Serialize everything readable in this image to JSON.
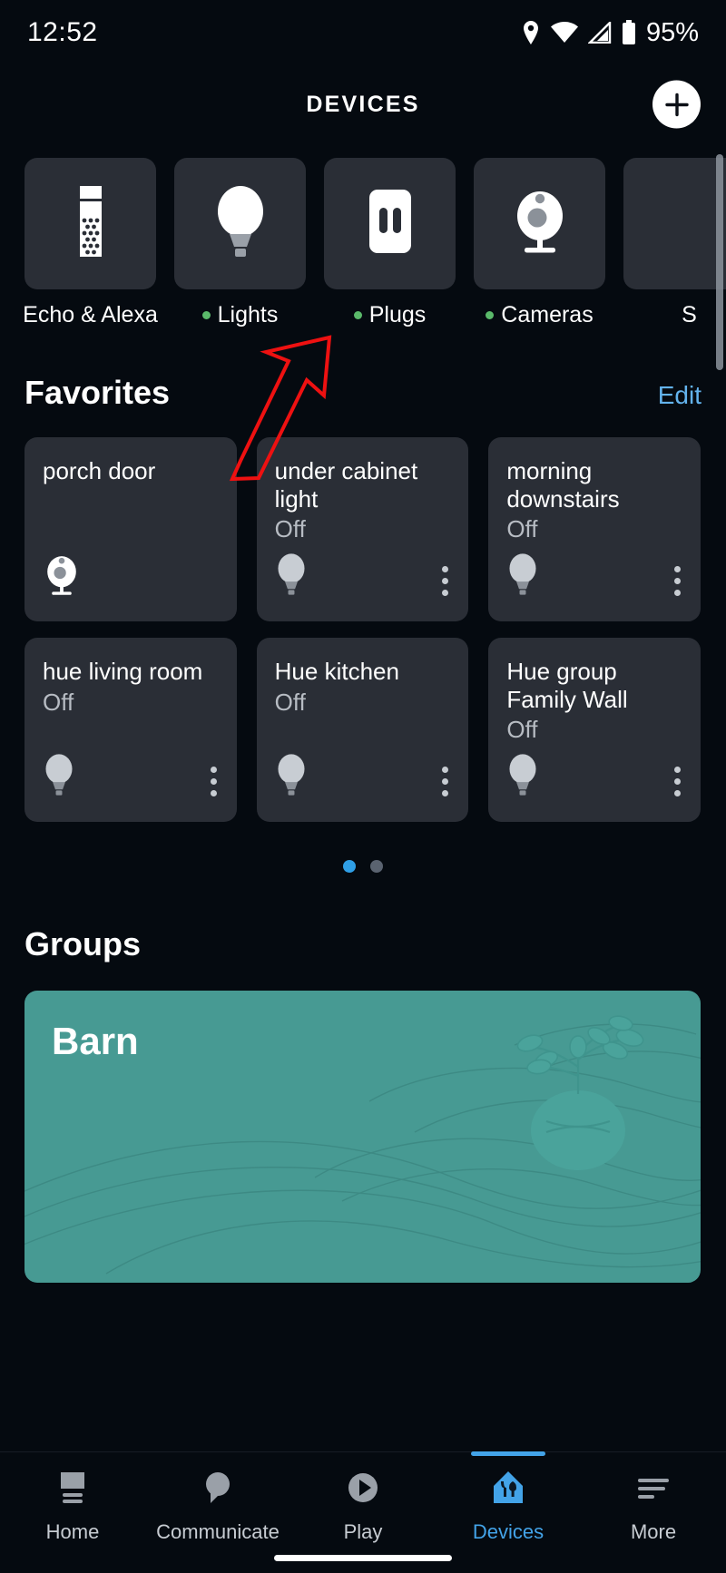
{
  "statusbar": {
    "time": "12:52",
    "battery_percent": "95%",
    "icons": [
      "location-pin-icon",
      "wifi-icon",
      "cellular-signal-icon",
      "battery-icon"
    ]
  },
  "header": {
    "title": "DEVICES",
    "add_label": "+"
  },
  "categories": [
    {
      "label": "Echo & Alexa",
      "icon": "echo-speaker-icon",
      "has_status_dot": false
    },
    {
      "label": "Lights",
      "icon": "light-bulb-icon",
      "has_status_dot": true
    },
    {
      "label": "Plugs",
      "icon": "wall-outlet-icon",
      "has_status_dot": true
    },
    {
      "label": "Cameras",
      "icon": "camera-icon",
      "has_status_dot": true
    },
    {
      "label": "S",
      "icon": "partial-tile-icon",
      "has_status_dot": false
    }
  ],
  "favorites": {
    "title": "Favorites",
    "edit_label": "Edit",
    "cards": [
      {
        "name": "porch door",
        "status": "",
        "icon": "camera-icon",
        "has_menu": false
      },
      {
        "name": "under cabinet light",
        "status": "Off",
        "icon": "light-bulb-icon",
        "has_menu": true
      },
      {
        "name": "morning downstairs",
        "status": "Off",
        "icon": "light-bulb-icon",
        "has_menu": true
      },
      {
        "name": "hue living room",
        "status": "Off",
        "icon": "light-bulb-icon",
        "has_menu": true
      },
      {
        "name": "Hue kitchen",
        "status": "Off",
        "icon": "light-bulb-icon",
        "has_menu": true
      },
      {
        "name": "Hue group Family Wall",
        "status": "Off",
        "icon": "light-bulb-icon",
        "has_menu": true
      }
    ],
    "pages": 2,
    "current_page": 1
  },
  "groups": {
    "title": "Groups",
    "cards": [
      {
        "name": "Barn",
        "color": "#479a93",
        "art": "plant-in-vase-illustration"
      }
    ]
  },
  "bottom_nav": {
    "items": [
      {
        "label": "Home",
        "icon": "home-icon",
        "active": false
      },
      {
        "label": "Communicate",
        "icon": "speech-bubble-icon",
        "active": false
      },
      {
        "label": "Play",
        "icon": "play-circle-icon",
        "active": false
      },
      {
        "label": "Devices",
        "icon": "devices-house-icon",
        "active": true
      },
      {
        "label": "More",
        "icon": "hamburger-more-icon",
        "active": false
      }
    ]
  },
  "annotation": {
    "type": "red-arrow",
    "color": "#ee1111",
    "points_to": "Plugs category tile"
  },
  "colors": {
    "background": "#050a10",
    "card": "#2a2e36",
    "accent": "#43a3e8",
    "link": "#63b3ed",
    "status_dot": "#5ab96a",
    "group_teal": "#479a93"
  }
}
